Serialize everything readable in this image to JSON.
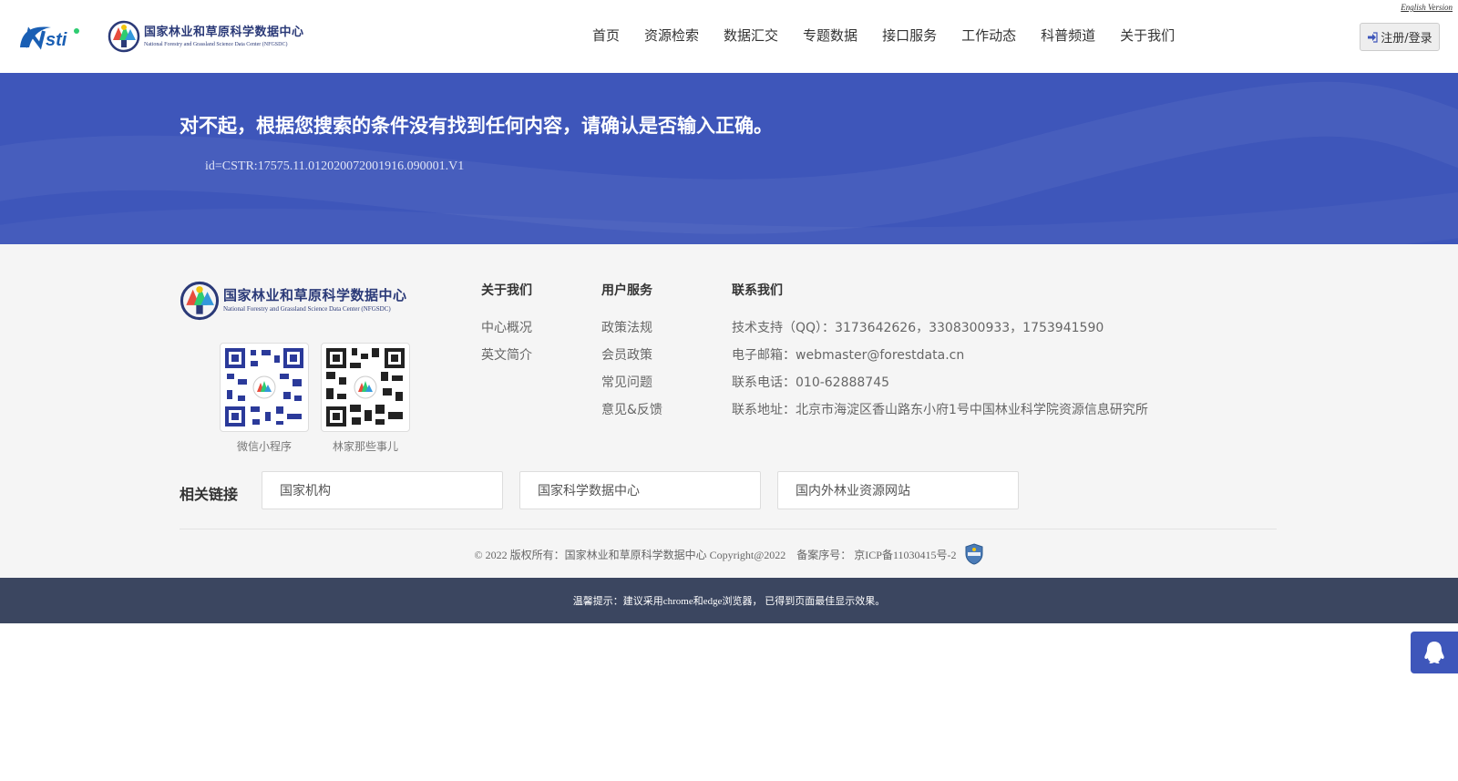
{
  "header": {
    "english_version": "English Version",
    "logo_cn": "国家林业和草原科学数据中心",
    "logo_en": "National Forestry and Grassland Science Data Center (NFGSDC)",
    "nav": [
      "首页",
      "资源检索",
      "数据汇交",
      "专题数据",
      "接口服务",
      "工作动态",
      "科普频道",
      "关于我们"
    ],
    "login_label": "注册/登录"
  },
  "banner": {
    "message": "对不起，根据您搜索的条件没有找到任何内容，请确认是否输入正确。",
    "query": "id=CSTR:17575.11.012020072001916.090001.V1",
    "background_color": "#3e56ba"
  },
  "footer": {
    "logo_cn": "国家林业和草原科学数据中心",
    "logo_en": "National Forestry and Grassland Science Data Center (NFGSDC)",
    "qr_codes": [
      {
        "label": "微信小程序"
      },
      {
        "label": "林家那些事儿"
      }
    ],
    "columns": {
      "about": {
        "title": "关于我们",
        "items": [
          "中心概况",
          "英文简介"
        ]
      },
      "services": {
        "title": "用户服务",
        "items": [
          "政策法规",
          "会员政策",
          "常见问题",
          "意见&反馈"
        ]
      },
      "contact": {
        "title": "联系我们",
        "items": [
          "技术支持（QQ）：3173642626，3308300933，1753941590",
          "电子邮箱：webmaster@forestdata.cn",
          "联系电话：010-62888745",
          "联系地址：北京市海淀区香山路东小府1号中国林业科学院资源信息研究所"
        ]
      }
    },
    "related_links": {
      "label": "相关链接",
      "items": [
        "国家机构",
        "国家科学数据中心",
        "国内外林业资源网站"
      ]
    },
    "copyright": "© 2022 版权所有：国家林业和草原科学数据中心 Copyright@2022    备案序号： 京ICP备11030415号-2"
  },
  "tip_bar": {
    "text": "温馨提示：建议采用chrome和edge浏览器， 已得到页面最佳显示效果。",
    "background_color": "#3b4660"
  },
  "icons": [
    "sign-in-icon",
    "qq-penguin-icon",
    "police-badge-icon",
    "qr-code-icon"
  ]
}
